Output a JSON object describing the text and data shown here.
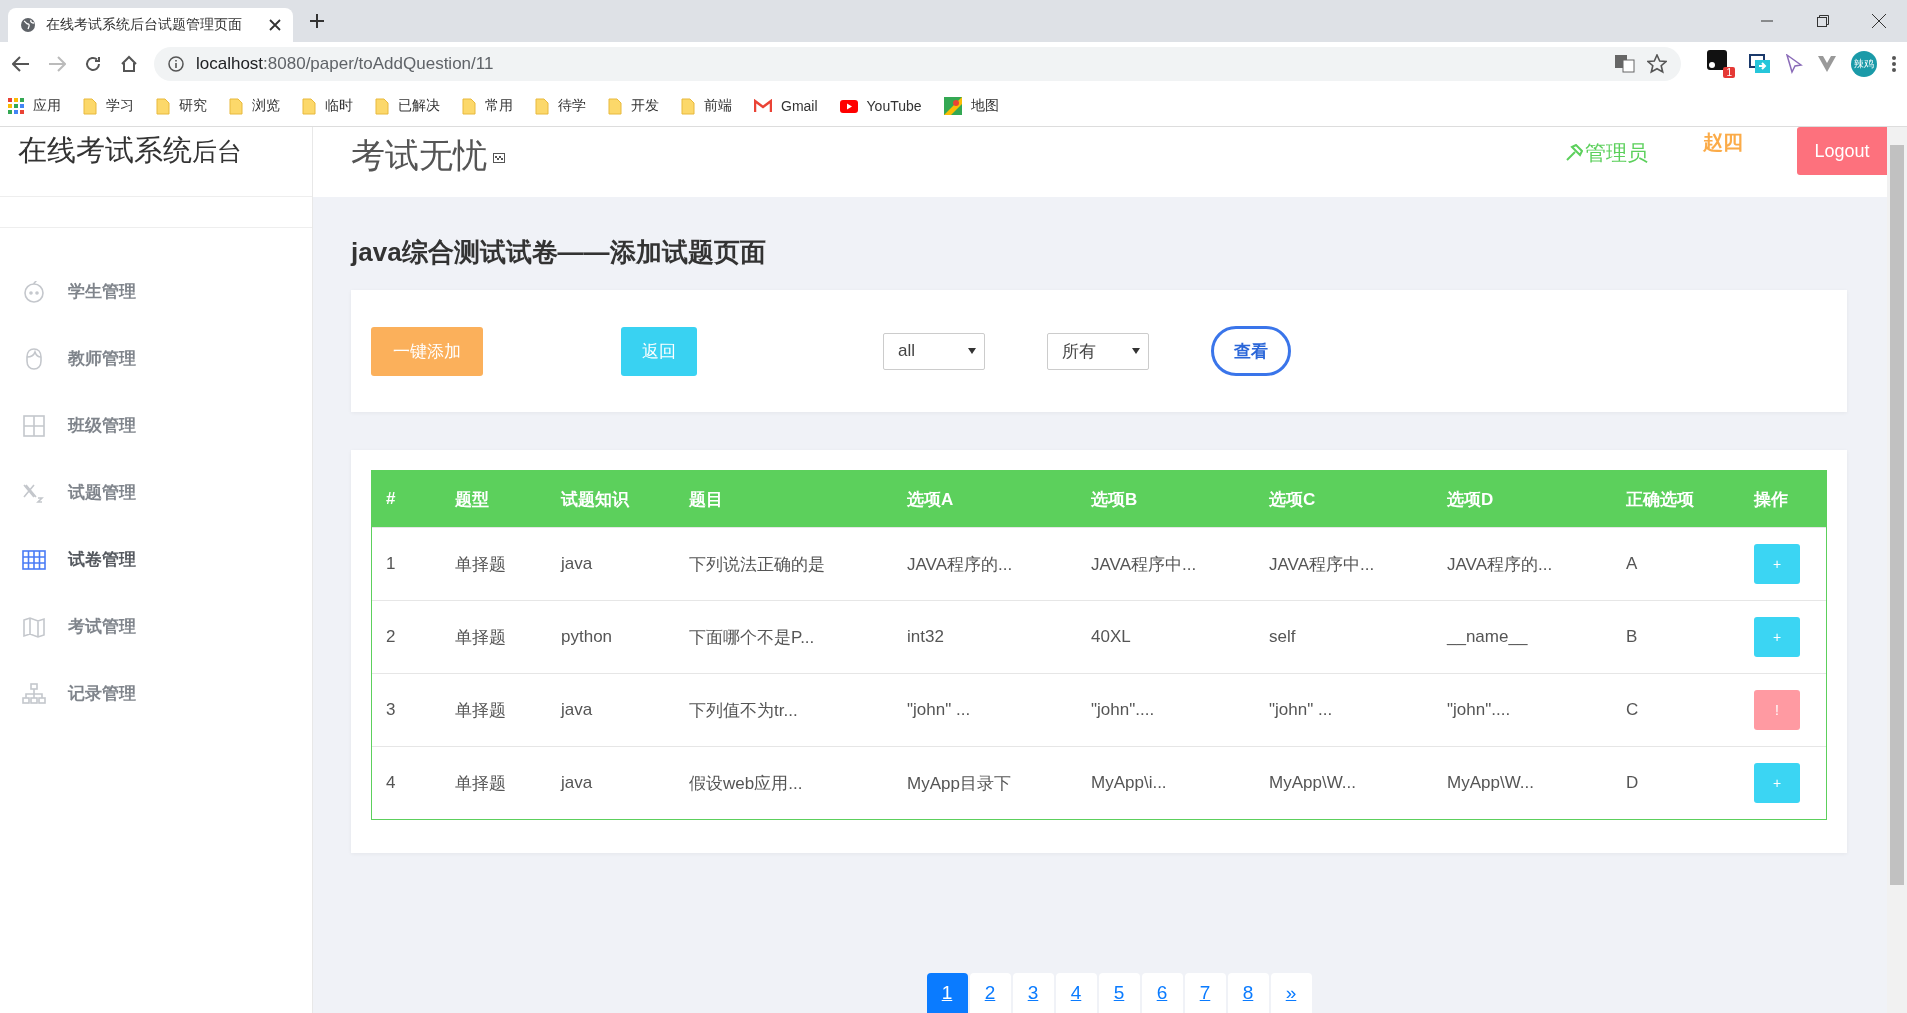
{
  "browser": {
    "tab_title": "在线考试系统后台试题管理页面",
    "url_host": "localhost",
    "url_path": ":8080/paper/toAddQuestion/11",
    "extension_badge": "1",
    "profile": "辣鸡",
    "bookmarks": [
      {
        "kind": "apps",
        "label": "应用"
      },
      {
        "kind": "folder",
        "label": "学习"
      },
      {
        "kind": "folder",
        "label": "研究"
      },
      {
        "kind": "folder",
        "label": "浏览"
      },
      {
        "kind": "folder",
        "label": "临时"
      },
      {
        "kind": "folder",
        "label": "已解决"
      },
      {
        "kind": "folder",
        "label": "常用"
      },
      {
        "kind": "folder",
        "label": "待学"
      },
      {
        "kind": "folder",
        "label": "开发"
      },
      {
        "kind": "folder",
        "label": "前端"
      },
      {
        "kind": "gmail",
        "label": "Gmail"
      },
      {
        "kind": "youtube",
        "label": "YouTube"
      },
      {
        "kind": "maps",
        "label": "地图"
      }
    ]
  },
  "sidebar": {
    "brand_main": "在线考试系统",
    "brand_sub": "后台",
    "items": [
      {
        "kind": "face",
        "label": "学生管理",
        "selected": false
      },
      {
        "kind": "head",
        "label": "教师管理",
        "selected": false
      },
      {
        "kind": "grid",
        "label": "班级管理",
        "selected": false
      },
      {
        "kind": "formula",
        "label": "试题管理",
        "selected": false
      },
      {
        "kind": "table",
        "label": "试卷管理",
        "selected": true
      },
      {
        "kind": "map",
        "label": "考试管理",
        "selected": false
      },
      {
        "kind": "tree",
        "label": "记录管理",
        "selected": false
      }
    ]
  },
  "header": {
    "title": "考试无忧",
    "role": "管理员",
    "user": "赵四",
    "logout": "Logout"
  },
  "page_title": "java综合测试试卷——添加试题页面",
  "toolbar": {
    "add_all": "一键添加",
    "back": "返回",
    "filters": [
      {
        "value": "all"
      },
      {
        "value": "所有"
      }
    ],
    "view": "查看"
  },
  "table": {
    "columns": [
      "#",
      "题型",
      "试题知识",
      "题目",
      "选项A",
      "选项B",
      "选项C",
      "选项D",
      "正确选项",
      "操作"
    ],
    "rows": [
      {
        "cells": [
          "1",
          "单择题",
          "java",
          "下列说法正确的是",
          "JAVA程序的...",
          "JAVA程序中...",
          "JAVA程序中...",
          "JAVA程序的...",
          "A"
        ],
        "action": {
          "kind": "add",
          "label": "+"
        }
      },
      {
        "cells": [
          "2",
          "单择题",
          "python",
          "下面哪个不是P...",
          "int32",
          "40XL",
          "self",
          "__name__",
          "B"
        ],
        "action": {
          "kind": "add",
          "label": "+"
        }
      },
      {
        "cells": [
          "3",
          "单择题",
          "java",
          "下列值不为tr...",
          "\"john\" ...",
          "\"john\"....",
          "\"john\" ...",
          "\"john\"....",
          "C"
        ],
        "action": {
          "kind": "warn",
          "label": "!"
        }
      },
      {
        "cells": [
          "4",
          "单择题",
          "java",
          "假设web应用...",
          "MyApp目录下",
          "MyApp\\i...",
          "MyApp\\W...",
          "MyApp\\W...",
          "D"
        ],
        "action": {
          "kind": "add",
          "label": "+"
        }
      }
    ]
  },
  "pagination": {
    "pages": [
      {
        "label": "1",
        "selected": true
      },
      {
        "label": "2",
        "selected": false
      },
      {
        "label": "3",
        "selected": false
      },
      {
        "label": "4",
        "selected": false
      },
      {
        "label": "5",
        "selected": false
      },
      {
        "label": "6",
        "selected": false
      },
      {
        "label": "7",
        "selected": false
      },
      {
        "label": "8",
        "selected": false
      }
    ],
    "next": "»"
  }
}
